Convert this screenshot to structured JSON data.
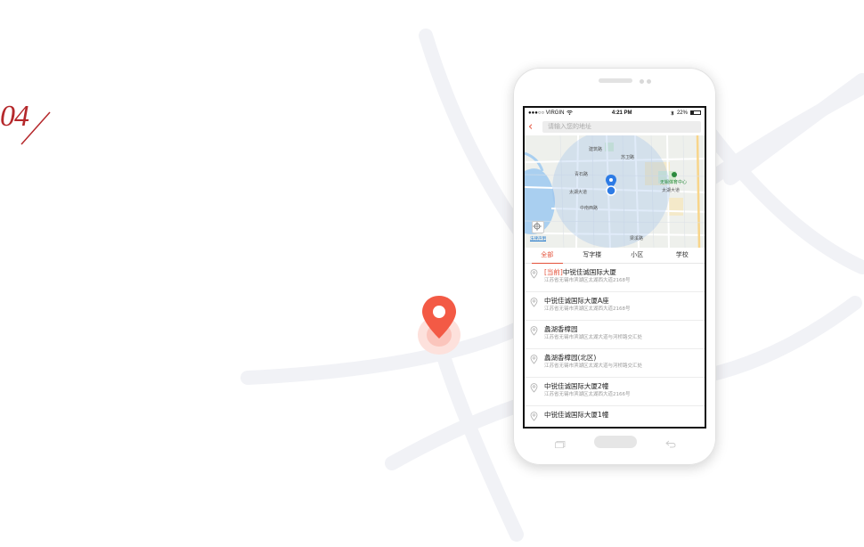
{
  "slide": {
    "number": "04"
  },
  "status_bar": {
    "carrier": "●●●○○ VIRGIN",
    "time": "4:21 PM",
    "battery": "22%",
    "wifi_icon": "wifi-icon",
    "bluetooth_icon": "bluetooth-icon"
  },
  "search": {
    "placeholder": "请输入您的地址",
    "back_icon": "back-arrow-icon"
  },
  "map": {
    "labels": [
      "建筑路",
      "苏卫路",
      "青石路",
      "太湖大道",
      "中南西路",
      "太湖大道",
      "梁溪路"
    ],
    "poi_label": "无锡体育中心",
    "credit": "法律声明",
    "water_color": "#a9cff0",
    "marker_color": "#2d7be5"
  },
  "tabs": [
    {
      "label": "全部",
      "active": true
    },
    {
      "label": "写字楼",
      "active": false
    },
    {
      "label": "小区",
      "active": false
    },
    {
      "label": "学校",
      "active": false
    }
  ],
  "results": [
    {
      "tag": "[当前]",
      "title": "中锐佳诚国际大厦",
      "address": "江苏省无锡市滨湖区太湖西大道2168号"
    },
    {
      "tag": "",
      "title": "中锐佳诚国际大厦A座",
      "address": "江苏省无锡市滨湖区太湖西大道2168号"
    },
    {
      "tag": "",
      "title": "蠡湖香樟园",
      "address": "江苏省无锡市滨湖区太湖大道与河桥路交汇处"
    },
    {
      "tag": "",
      "title": "蠡湖香樟园(北区)",
      "address": "江苏省无锡市滨湖区太湖大道与河桥路交汇处"
    },
    {
      "tag": "",
      "title": "中锐佳诚国际大厦2幢",
      "address": "江苏省无锡市滨湖区太湖西大道2166号"
    },
    {
      "tag": "",
      "title": "中锐佳诚国际大厦1幢",
      "address": ""
    }
  ],
  "colors": {
    "accent": "#e4513a",
    "slide_number": "#b5282b"
  }
}
